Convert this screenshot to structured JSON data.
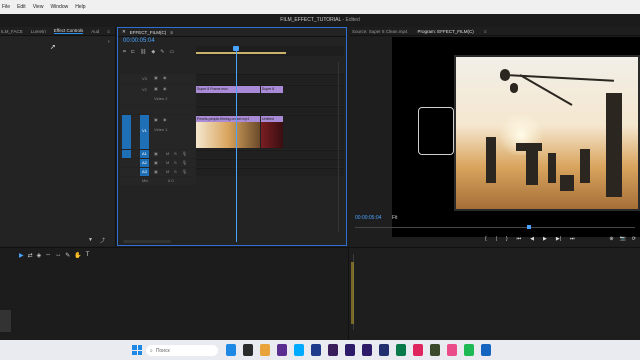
{
  "menu": {
    "items": [
      "File",
      "Edit",
      "View",
      "Window",
      "Help"
    ]
  },
  "window": {
    "title": "FILM_EFFECT_TUTORIAL",
    "status": "- Edited"
  },
  "left_panel": {
    "tabs": [
      "ILM_FACE",
      "Lumetri",
      "Effect Controls",
      "Aud"
    ],
    "active_tab": "Effect Controls"
  },
  "timeline": {
    "tab": "EFFECT_FILM(C)",
    "timecode": "00:00:05:04",
    "tracks": {
      "v3": "V3",
      "v2": "V2",
      "v1_label": "Video 1",
      "v1": "V1",
      "a1": "A1",
      "a2": "A2",
      "a3": "A3",
      "mix": "Mix",
      "mix_value": "0.0",
      "video2_label": "Video 2"
    },
    "clips": {
      "adjustment_a": "Super 8 Frame.mov",
      "adjustment_b": "Super 8",
      "main_clip": "Pexels-people-filming-on-set.mp4",
      "second_clip": "Untitled"
    }
  },
  "program": {
    "source_tab": "Source: Super 8 Clean.mp4",
    "program_tab": "Program: EFFECT_FILM(C)",
    "timecode": "00:00:05:04",
    "fit": "Fit",
    "transport": [
      "{",
      "|",
      "}",
      "⏮",
      "◀",
      "▶",
      "▶|",
      "⏭"
    ],
    "right_icons": [
      "⊕",
      "📷",
      "⟳"
    ]
  },
  "tools": {
    "items": [
      "▶",
      "⇄",
      "◈",
      "⇔",
      "↔",
      "✎",
      "✋",
      "T"
    ]
  },
  "taskbar": {
    "search_placeholder": "Поиск",
    "colors": [
      "#1e88e5",
      "#2b2b2b",
      "#e8a33a",
      "#5c2d91",
      "#00aaff",
      "#1e3a8a",
      "#3a1e5c",
      "#2d1b69",
      "#2d1b69",
      "#23306e",
      "#0b7a4b",
      "#e0245e",
      "#3b4a2a",
      "#ea4c89",
      "#1db954",
      "#1565c0"
    ]
  }
}
